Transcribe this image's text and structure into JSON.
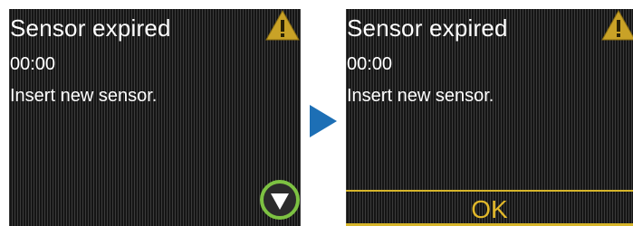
{
  "screens": [
    {
      "title": "Sensor expired",
      "time": "00:00",
      "message": "Insert new sensor."
    },
    {
      "title": "Sensor expired",
      "time": "00:00",
      "message": "Insert new sensor.",
      "ok_label": "OK"
    }
  ],
  "icons": {
    "warning": "warning-icon",
    "scroll_down": "scroll-down-icon",
    "next_step": "next-step-arrow-icon"
  },
  "colors": {
    "warning_yellow": "#c9a227",
    "ok_text": "#e2b82a",
    "highlight_ring": "#7dc242",
    "step_arrow": "#1d6fb5"
  }
}
